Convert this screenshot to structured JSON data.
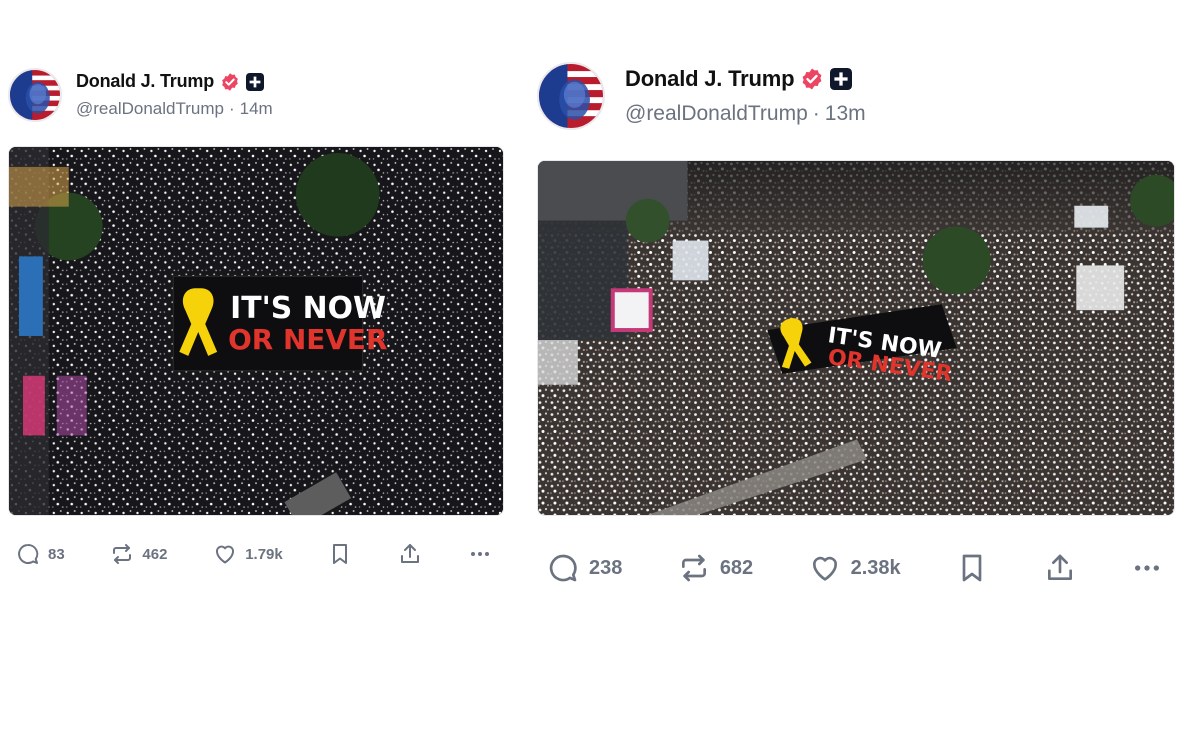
{
  "posts": [
    {
      "author": {
        "name": "Donald J. Trump",
        "handle": "@realDonaldTrump",
        "time": "14m"
      },
      "media": {
        "banner_line1": "IT'S NOW",
        "banner_line2": "OR NEVER"
      },
      "stats": {
        "replies": "83",
        "reposts": "462",
        "likes": "1.79k"
      }
    },
    {
      "author": {
        "name": "Donald J. Trump",
        "handle": "@realDonaldTrump",
        "time": "13m"
      },
      "media": {
        "banner_line1": "IT'S NOW",
        "banner_line2": "OR NEVER"
      },
      "stats": {
        "replies": "238",
        "reposts": "682",
        "likes": "2.38k"
      }
    }
  ],
  "separator": "·",
  "colors": {
    "verified": "#ec4463",
    "muted": "#6b7280",
    "banner_yellow": "#f5d20a",
    "banner_red": "#e0342c"
  },
  "icons": [
    "verified-badge-icon",
    "plus-badge-icon",
    "reply-icon",
    "repost-icon",
    "like-icon",
    "bookmark-icon",
    "share-icon",
    "more-icon"
  ]
}
